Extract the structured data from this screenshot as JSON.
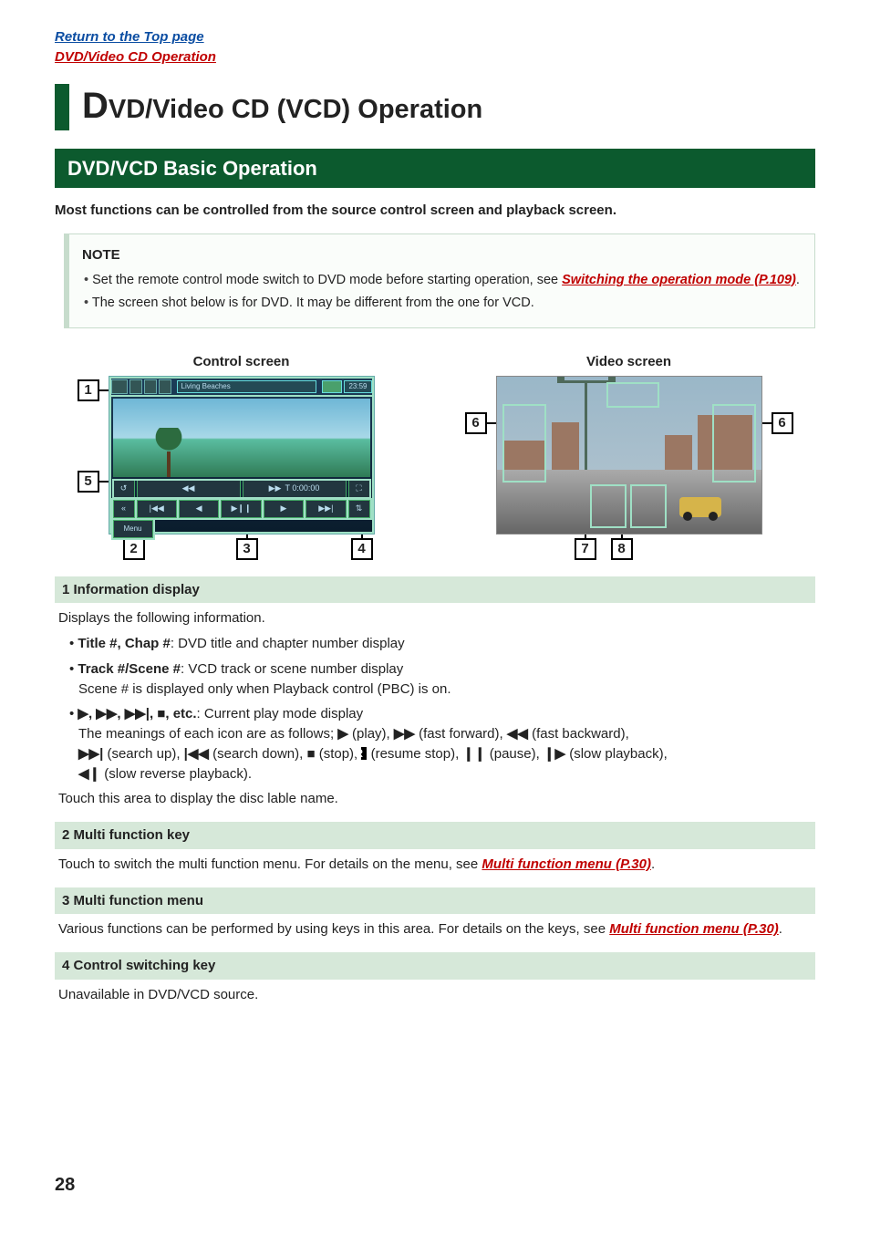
{
  "nav": {
    "top_link": "Return to the Top page",
    "section_link": "DVD/Video CD Operation"
  },
  "title": {
    "cap": "D",
    "rest": "VD/Video CD (VCD) Operation"
  },
  "section_bar": "DVD/VCD Basic Operation",
  "intro": "Most functions can be controlled from the source control screen and playback screen.",
  "note": {
    "title": "NOTE",
    "bullets": [
      {
        "pre": "Set the remote control mode switch to DVD mode before starting operation, see ",
        "link": "Switching the operation mode (P.109)",
        "post": "."
      },
      {
        "pre": "The screen shot below is for DVD. It may be different from the one for VCD.",
        "link": "",
        "post": ""
      }
    ]
  },
  "screens": {
    "control_label": "Control screen",
    "video_label": "Video screen",
    "control": {
      "disc_label": "Living Beaches",
      "clock": "23:59",
      "time": "T 0:00:00",
      "menu_btn": "Menu",
      "callouts": {
        "c1": "1",
        "c2": "2",
        "c3": "3",
        "c4": "4",
        "c5": "5"
      }
    },
    "video": {
      "callouts": {
        "c6l": "6",
        "c6r": "6",
        "c7": "7",
        "c8": "8"
      }
    }
  },
  "items": {
    "i1": {
      "head": "1  Information display",
      "p1": "Displays the following information.",
      "b1_head": "Title #, Chap #",
      "b1_rest": ": DVD title and chapter number display",
      "b2_head": "Track #/Scene #",
      "b2_rest": ": VCD track or scene number display",
      "b2_sub": "Scene # is displayed only when Playback control (PBC) is on.",
      "b3_pre": "",
      "b3_head": "▶, ▶▶, ▶▶|, ■, etc.",
      "b3_rest": ": Current play mode display",
      "b3_line2a": "The meanings of each icon are as follows; ",
      "b3_play": "▶",
      "b3_play_t": " (play), ",
      "b3_ff": "▶▶",
      "b3_ff_t": " (fast forward), ",
      "b3_fb": "◀◀",
      "b3_fb_t": " (fast backward),",
      "b3_su": "▶▶|",
      "b3_su_t": " (search up), ",
      "b3_sd": "|◀◀",
      "b3_sd_t": " (search down), ",
      "b3_stop": "■",
      "b3_stop_t": " (stop), ",
      "b3_rs": "R",
      "b3_rs_t": " (resume stop), ",
      "b3_pause": "❙❙",
      "b3_pause_t": " (pause), ",
      "b3_sp": "❙▶",
      "b3_sp_t": " (slow playback),",
      "b3_srp": "◀❙",
      "b3_srp_t": " (slow reverse playback).",
      "p2": "Touch this area to display the disc lable name."
    },
    "i2": {
      "head": "2  Multi function key",
      "p1_a": "Touch to switch the multi function menu. For details on the menu, see ",
      "p1_link": "Multi function menu (P.30)",
      "p1_b": "."
    },
    "i3": {
      "head": "3  Multi function menu",
      "p1_a": "Various functions can be performed by using keys in this area. For details on the keys, see ",
      "p1_link": "Multi function menu (P.30)",
      "p1_b": "."
    },
    "i4": {
      "head": "4  Control switching key",
      "p1": "Unavailable in DVD/VCD source."
    }
  },
  "page_number": "28"
}
